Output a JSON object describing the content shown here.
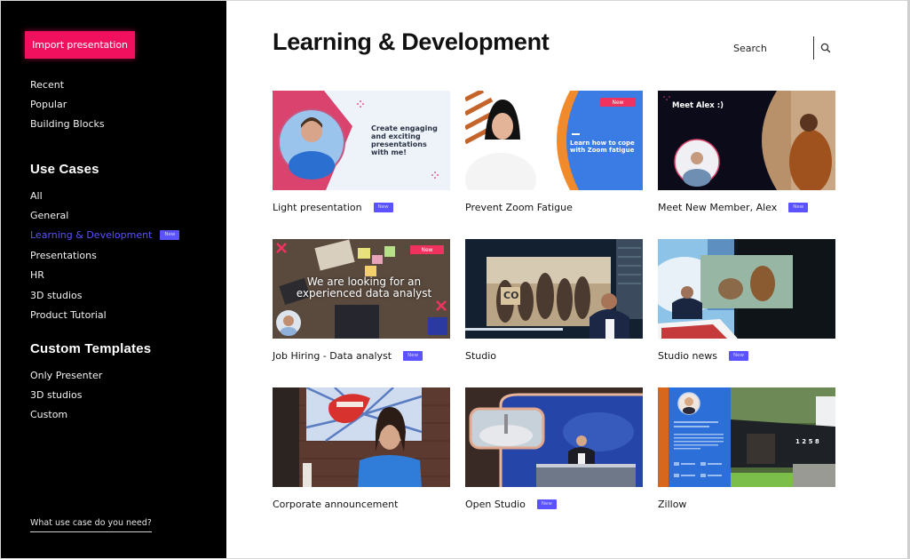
{
  "sidebar": {
    "import_button": "Import presentation",
    "top_links": [
      {
        "label": "Recent"
      },
      {
        "label": "Popular"
      },
      {
        "label": "Building Blocks"
      }
    ],
    "use_cases_title": "Use Cases",
    "use_cases": [
      {
        "label": "All"
      },
      {
        "label": "General"
      },
      {
        "label": "Learning & Development",
        "active": true,
        "badge": "New"
      },
      {
        "label": "Presentations"
      },
      {
        "label": "HR"
      },
      {
        "label": "3D studios"
      },
      {
        "label": "Product Tutorial"
      }
    ],
    "custom_title": "Custom Templates",
    "custom_templates": [
      {
        "label": "Only Presenter"
      },
      {
        "label": "3D studios"
      },
      {
        "label": "Custom"
      }
    ],
    "help_link": "What use case do you need?"
  },
  "header": {
    "title": "Learning & Development",
    "search_placeholder": "Search"
  },
  "templates": [
    {
      "title": "Light presentation",
      "badge": "New",
      "thumb_text": "Create engaging and exciting presentations with me!"
    },
    {
      "title": "Prevent Zoom Fatigue",
      "badge": null,
      "thumb_text": "Learn how to cope with Zoom fatigue",
      "thumb_ribbon": "New"
    },
    {
      "title": "Meet New Member, Alex",
      "badge": "New",
      "thumb_text": "Meet Alex :)"
    },
    {
      "title": "Job Hiring - Data analyst",
      "badge": "New",
      "thumb_text": "We are looking for an experienced data analyst",
      "thumb_ribbon": "New"
    },
    {
      "title": "Studio",
      "badge": null,
      "thumb_text": "CO"
    },
    {
      "title": "Studio news",
      "badge": "New"
    },
    {
      "title": "Corporate announcement",
      "badge": null
    },
    {
      "title": "Open Studio",
      "badge": "New"
    },
    {
      "title": "Zillow",
      "badge": null,
      "thumb_text": "1 2 5 8"
    }
  ],
  "colors": {
    "accent_pink": "#f0105e",
    "accent_purple": "#5b53ff",
    "sidebar_bg": "#000000"
  }
}
